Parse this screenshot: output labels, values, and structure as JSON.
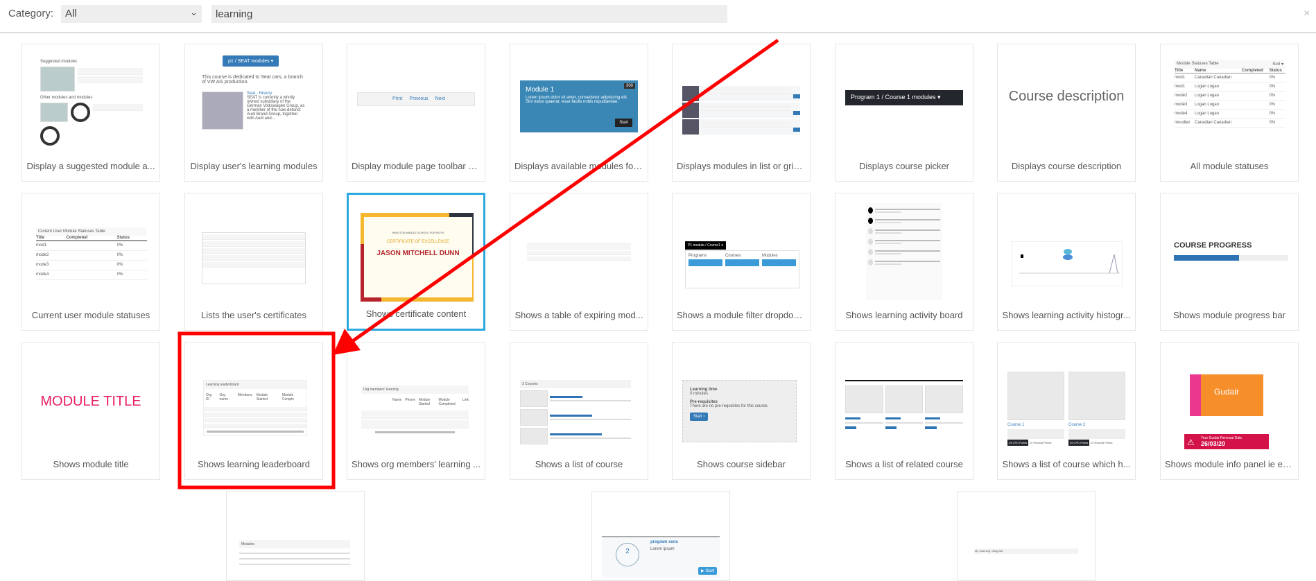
{
  "toolbar": {
    "category_label": "Category:",
    "category_value": "All",
    "search_value": "learning",
    "close_icon": "×"
  },
  "colors": {
    "highlight_border": "#2aa9e0",
    "annotation_red": "#ff0000",
    "primary": "#337ab7",
    "module_title": "#e91e63"
  },
  "cards": [
    {
      "label": "Display a suggested module a...",
      "thumb": {
        "title": "Suggested modules",
        "sub": "Other modules and modules"
      }
    },
    {
      "label": "Display user's learning modules",
      "thumb": {
        "button": "p1 / SEAT modules ▾",
        "text": "This course is dedicated to Seat cars, a branch of VW AG production.",
        "item": "Seat - History",
        "item_text": "SEAT is currently a wholly owned subsidiary of the German Volkswagen Group, as a member of the now defunct Audi Brand Group, together with Audi and..."
      }
    },
    {
      "label": "Display module page toolbar n...",
      "thumb": {
        "print": "Print",
        "previous": "Previous",
        "next": "Next"
      }
    },
    {
      "label": "Displays available modules for ...",
      "thumb": {
        "title": "Module 1",
        "badge": "300",
        "text": "Lorem ipsum dolor sit amet, consectetur adipisicing elit. Sint natus quaerat, esse facilis nobis repudiandae.",
        "button": "Start"
      }
    },
    {
      "label": "Displays modules in list or grid ...",
      "thumb": {}
    },
    {
      "label": "Displays course picker",
      "thumb": {
        "button": "Program 1 / Course 1 modules ▾"
      }
    },
    {
      "label": "Displays course description",
      "thumb": {
        "text": "Course description"
      }
    },
    {
      "label": "All module statuses",
      "thumb": {
        "title": "Module Statuses Table",
        "sort": "Sort ▾",
        "headers": [
          "Title",
          "Name",
          "Completed",
          "Status"
        ],
        "rows": [
          [
            "mod1",
            "Canadian Canadian",
            "",
            "0%"
          ],
          [
            "mod1",
            "Logan Logan",
            "",
            "0%"
          ],
          [
            "mode2",
            "Logan Logan",
            "",
            "0%"
          ],
          [
            "mode3",
            "Logan Logan",
            "",
            "0%"
          ],
          [
            "mode4",
            "Logan Logan",
            "",
            "0%"
          ],
          [
            "moudlez",
            "Canadian Canadian",
            "",
            "0%"
          ]
        ]
      }
    },
    {
      "label": "Current user module statuses",
      "thumb": {
        "title": "Current User Module Statuses Table",
        "headers": [
          "Title",
          "Completed",
          "Status"
        ],
        "rows": [
          [
            "mod1",
            "",
            "0%"
          ],
          [
            "mode2",
            "",
            "0%"
          ],
          [
            "mode3",
            "",
            "0%"
          ],
          [
            "mode4",
            "",
            "0%"
          ]
        ]
      }
    },
    {
      "label": "Lists the user's certificates",
      "thumb": {}
    },
    {
      "label": "Shows certificate content",
      "thumb": {
        "school": "WINSTON MIDDLE SCHOOL FOR BOYS",
        "title": "CERTIFICATE OF EXCELLENCE",
        "name": "JASON MITCHELL DUNN"
      }
    },
    {
      "label": "Shows a table of expiring mod...",
      "thumb": {}
    },
    {
      "label": "Shows a module filter dropdow...",
      "thumb": {
        "button": "P1 module / Course1 ▾",
        "cols": [
          "Programs",
          "Courses",
          "Modules"
        ]
      }
    },
    {
      "label": "Shows learning activity board",
      "thumb": {}
    },
    {
      "label": "Shows learning activity histogr...",
      "thumb": {}
    },
    {
      "label": "Shows module progress bar",
      "thumb": {
        "title": "COURSE PROGRESS",
        "progress": 0.57
      }
    },
    {
      "label": "Shows module title",
      "thumb": {
        "text": "MODULE TITLE"
      }
    },
    {
      "label": "Shows learning leaderboard",
      "thumb": {
        "title": "Learning leaderboard",
        "headers": [
          "Org ID",
          "Org name",
          "Members",
          "Module Started",
          "Module Comple"
        ]
      }
    },
    {
      "label": "Shows org members' learning ...",
      "thumb": {
        "title": "Org members' learning",
        "headers": [
          "Name",
          "Phone",
          "Module Started",
          "Module Completed",
          "Link"
        ]
      }
    },
    {
      "label": "Shows a list of course",
      "thumb": {
        "title": "3 Courses"
      }
    },
    {
      "label": "Shows course sidebar",
      "thumb": {
        "h1": "Learning time",
        "v1": "0 minutes",
        "h2": "Pre-requisites",
        "v2": "There are no pre-requisites for this course.",
        "button": "Start ›"
      }
    },
    {
      "label": "Shows a list of related course",
      "thumb": {}
    },
    {
      "label": "Shows a list of course which h...",
      "thumb": {
        "c1": "Course 1",
        "c2": "Course 2",
        "b1": "25 CPD Points",
        "b2": "10 Reward Points"
      }
    },
    {
      "label": "Shows module info panel ie ex...",
      "thumb": {
        "product": "Gudair",
        "banner": "Your Gudair Renewal Date",
        "date": "26/03/20"
      }
    },
    {
      "label": "",
      "thumb": {
        "title": "Modules"
      }
    },
    {
      "label": "",
      "thumb": {
        "count": "2",
        "title": "program sons",
        "sub": "Lorem ipsum",
        "button": "▶ Start"
      }
    },
    {
      "label": "",
      "thumb": {
        "text": "My Learning / Blog title"
      }
    }
  ]
}
